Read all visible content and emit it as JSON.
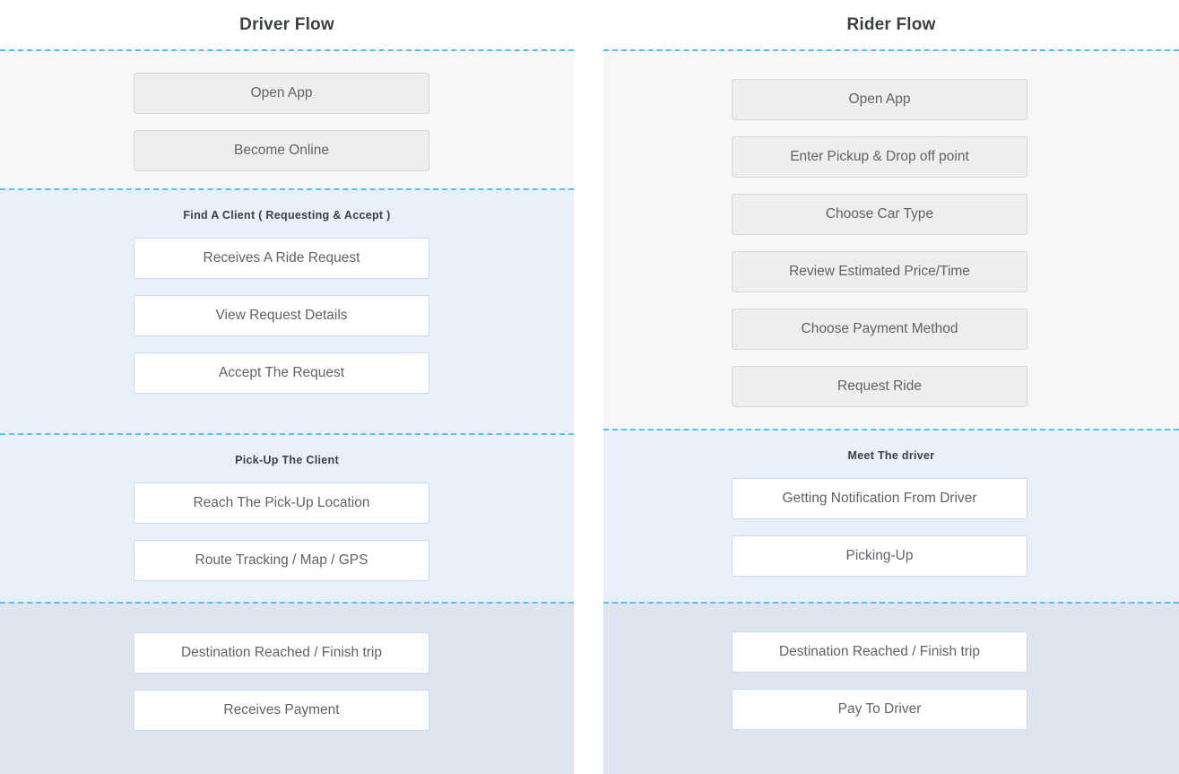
{
  "columns": [
    {
      "title": "Driver Flow",
      "stages": [
        {
          "label": "",
          "nodes": [
            {
              "text": "Open App",
              "style": "gray"
            },
            {
              "text": "Become Online",
              "style": "gray"
            }
          ]
        },
        {
          "label": "Find A Client ( Requesting & Accept )",
          "nodes": [
            {
              "text": "Receives A Ride Request",
              "style": "white"
            },
            {
              "text": "View Request Details",
              "style": "white"
            },
            {
              "text": "Accept The Request",
              "style": "white"
            }
          ]
        },
        {
          "label": "Pick-Up The Client",
          "nodes": [
            {
              "text": "Reach The Pick-Up Location",
              "style": "white"
            },
            {
              "text": "Route Tracking / Map / GPS",
              "style": "white"
            }
          ]
        },
        {
          "label": "",
          "nodes": [
            {
              "text": "Destination Reached / Finish trip",
              "style": "white"
            },
            {
              "text": "Receives Payment",
              "style": "white"
            }
          ]
        }
      ]
    },
    {
      "title": "Rider Flow",
      "stages": [
        {
          "label": "",
          "nodes": [
            {
              "text": "Open App",
              "style": "gray"
            },
            {
              "text": "Enter Pickup & Drop off point",
              "style": "gray"
            },
            {
              "text": "Choose Car Type",
              "style": "gray"
            },
            {
              "text": "Review Estimated Price/Time",
              "style": "gray"
            },
            {
              "text": "Choose Payment Method",
              "style": "gray"
            },
            {
              "text": "Request Ride",
              "style": "gray"
            }
          ]
        },
        {
          "label": "Meet The driver",
          "nodes": [
            {
              "text": "Getting Notification From Driver",
              "style": "white"
            },
            {
              "text": "Picking-Up",
              "style": "white"
            }
          ]
        },
        {
          "label": "",
          "nodes": [
            {
              "text": "Destination Reached / Finish trip",
              "style": "white"
            },
            {
              "text": "Pay To Driver",
              "style": "white"
            }
          ]
        }
      ]
    }
  ],
  "colors": {
    "divider": "#4fc3f7",
    "stage_gray": "#f7f7f7",
    "stage_blue": "#e8f0fc",
    "stage_steel": "#dfe5f0",
    "node_gray_fill": "#eeeeee",
    "node_white_fill": "#ffffff",
    "node_white_border": "#c9dcf3",
    "text": "#5f6368",
    "title_text": "#3c4043"
  }
}
